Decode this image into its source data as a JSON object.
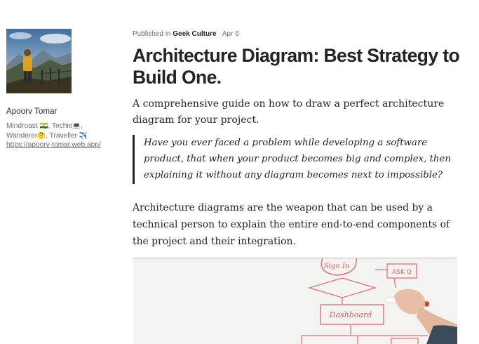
{
  "author": {
    "name": "Apoorv Tomar",
    "bio_line1_a": "Mindroast ",
    "bio_line1_flag": "🇮🇳",
    "bio_line1_b": ", Techie",
    "bio_line1_pc": "💻",
    "bio_line1_c": ",",
    "bio_line2_a": "Wanderer",
    "bio_line2_emoji": "🤔",
    "bio_line2_b": ", Traveller ",
    "bio_line2_plane": "✈️",
    "link": "https://apoorv-tomar.web.app/"
  },
  "article": {
    "published_prefix": "Published in ",
    "publication": "Geek Culture",
    "separator": " · ",
    "date": "Apr 6",
    "title": "Architecture Diagram: Best Strategy to Build One.",
    "subtitle": "A comprehensive guide on how to draw a perfect architecture diagram for your project.",
    "quote": "Have you ever faced a problem while developing a software product, that when your product becomes big and complex, then explaining it without any diagram becomes next to impossible?",
    "paragraph": "Architecture diagrams are the weapon that can be used by a technical person to explain the entire end-to-end components of the project and their integration."
  },
  "figure": {
    "labels": [
      "Sign In",
      "ASK Q",
      "Dashboard"
    ]
  }
}
